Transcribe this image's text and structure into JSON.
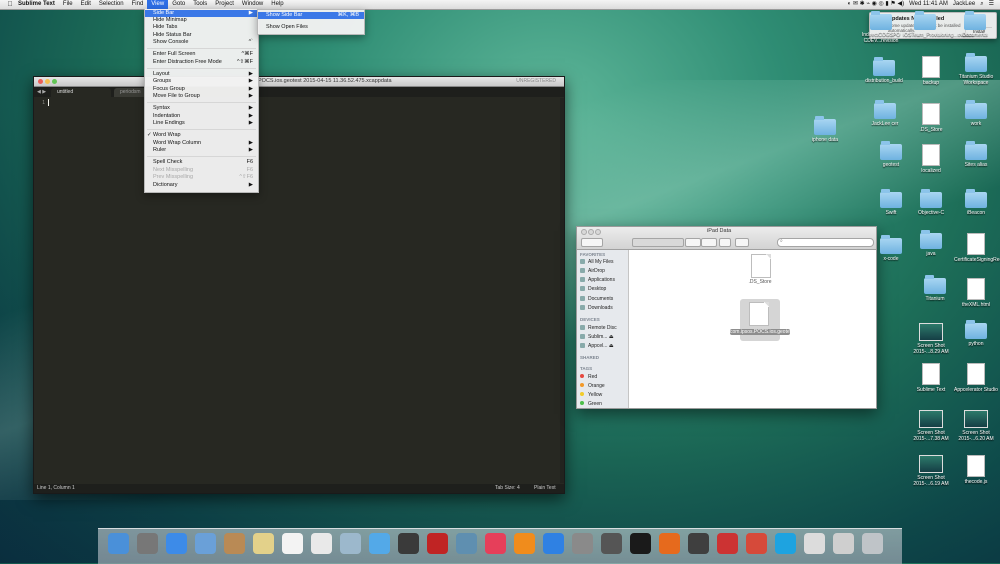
{
  "menubar": {
    "app": "Sublime Text",
    "items": [
      "File",
      "Edit",
      "Selection",
      "Find",
      "View",
      "Goto",
      "Tools",
      "Project",
      "Window",
      "Help"
    ],
    "active_index": 4,
    "clock": "Wed 11:41 AM",
    "user": "JackLee"
  },
  "view_menu": {
    "items": [
      {
        "label": "Side Bar",
        "shortcut": "▶",
        "state": "highlighted"
      },
      {
        "label": "Hide Minimap",
        "shortcut": ""
      },
      {
        "label": "Hide Tabs",
        "shortcut": ""
      },
      {
        "label": "Hide Status Bar",
        "shortcut": ""
      },
      {
        "label": "Show Console",
        "shortcut": "^`"
      },
      {
        "label": "Enter Full Screen",
        "shortcut": "^⌘F"
      },
      {
        "label": "Enter Distraction Free Mode",
        "shortcut": "^⇧⌘F"
      },
      {
        "label": "Layout",
        "shortcut": "▶"
      },
      {
        "label": "Groups",
        "shortcut": "▶"
      },
      {
        "label": "Focus Group",
        "shortcut": "▶"
      },
      {
        "label": "Move File to Group",
        "shortcut": "▶"
      },
      {
        "label": "Syntax",
        "shortcut": "▶"
      },
      {
        "label": "Indentation",
        "shortcut": "▶"
      },
      {
        "label": "Line Endings",
        "shortcut": "▶"
      },
      {
        "label": "Word Wrap",
        "shortcut": "",
        "checked": true
      },
      {
        "label": "Word Wrap Column",
        "shortcut": "▶"
      },
      {
        "label": "Ruler",
        "shortcut": "▶"
      },
      {
        "label": "Spell Check",
        "shortcut": "F6"
      },
      {
        "label": "Next Misspelling",
        "shortcut": "F6",
        "state": "disabled"
      },
      {
        "label": "Prev Misspelling",
        "shortcut": "^⇧F6",
        "state": "disabled"
      },
      {
        "label": "Dictionary",
        "shortcut": "▶"
      }
    ]
  },
  "sidebar_submenu": {
    "items": [
      {
        "label": "Show Side Bar",
        "shortcut": "⌘K, ⌘B",
        "state": "highlighted"
      },
      {
        "label": "Show Open Files",
        "shortcut": ""
      }
    ]
  },
  "sublime": {
    "title": "POCS.ios.geotest 2015-04-15 11.36.52.475.xcappdata",
    "unregistered": "UNREGISTERED",
    "tabs": [
      "untitled",
      "periodsm"
    ],
    "line_number": "1",
    "status_left": "Line 1, Column 1",
    "tab_size": "Tab Size: 4",
    "syntax": "Plain Text"
  },
  "finder": {
    "title": "iPad Data",
    "search_placeholder": "",
    "sections": {
      "favorites": "FAVORITES",
      "devices": "DEVICES",
      "shared": "SHARED",
      "tags": "TAGS"
    },
    "favorites": [
      "All My Files",
      "AirDrop",
      "Applications",
      "Desktop",
      "Documents",
      "Downloads"
    ],
    "devices": [
      "Remote Disc",
      "Sublim...",
      "Appcel..."
    ],
    "tags": [
      {
        "label": "Red",
        "color": "#e5483f"
      },
      {
        "label": "Orange",
        "color": "#f39a2a"
      },
      {
        "label": "Yellow",
        "color": "#f2cc2a"
      },
      {
        "label": "Green",
        "color": "#4cbf4a"
      }
    ],
    "files": [
      {
        "name": ".DS_Store"
      },
      {
        "name": "com.ipsos.POCS.ios.geotest...xcappdata"
      }
    ]
  },
  "notification": {
    "title": "Updates Not Installed",
    "body": "Some updates could not be installed automatically.",
    "details": "Details",
    "install": "Install"
  },
  "desktop": [
    {
      "label": "IndirectCOGSPO CDEV...revision",
      "type": "folder"
    },
    {
      "label": "iOSTeam_Provisioning...ovision",
      "type": "folder"
    },
    {
      "label": "Documents",
      "type": "folder"
    },
    {
      "label": "distribution_build",
      "type": "folder"
    },
    {
      "label": "backup",
      "type": "doc"
    },
    {
      "label": "Titanium Studio Workspace",
      "type": "folder"
    },
    {
      "label": "iphone data",
      "type": "folder"
    },
    {
      "label": "JackLee cer",
      "type": "folder"
    },
    {
      "label": ".DS_Store",
      "type": "doc"
    },
    {
      "label": "work",
      "type": "folder"
    },
    {
      "label": "geotest",
      "type": "folder"
    },
    {
      "label": "localized",
      "type": "doc"
    },
    {
      "label": "Sites alias",
      "type": "folder"
    },
    {
      "label": "Swift",
      "type": "folder"
    },
    {
      "label": "Objective-C",
      "type": "folder"
    },
    {
      "label": "iBeacon",
      "type": "folder"
    },
    {
      "label": "x-code",
      "type": "folder"
    },
    {
      "label": "java",
      "type": "folder"
    },
    {
      "label": "CertificateSigningRequ...Request",
      "type": "doc"
    },
    {
      "label": "Titanium",
      "type": "folder"
    },
    {
      "label": "theXML.html",
      "type": "doc"
    },
    {
      "label": "Screen Shot 2015-...8.29 AM",
      "type": "shot"
    },
    {
      "label": "python",
      "type": "folder"
    },
    {
      "label": "Sublime Text",
      "type": "doc"
    },
    {
      "label": "Appcelerator Studio",
      "type": "doc"
    },
    {
      "label": "Screen Shot 2015-...7.38 AM",
      "type": "shot"
    },
    {
      "label": "Screen Shot 2015-...6.20 AM",
      "type": "shot"
    },
    {
      "label": "Screen Shot 2015-...6.19 AM",
      "type": "shot"
    },
    {
      "label": "thecode.js",
      "type": "doc"
    }
  ],
  "dock": [
    {
      "name": "finder",
      "color": "#4a90d9"
    },
    {
      "name": "launchpad",
      "color": "#777"
    },
    {
      "name": "safari",
      "color": "#3d8be8"
    },
    {
      "name": "mail",
      "color": "#6aa0d8"
    },
    {
      "name": "contacts",
      "color": "#b98a55"
    },
    {
      "name": "notes",
      "color": "#e3d18a"
    },
    {
      "name": "calendar",
      "color": "#f3f3f3"
    },
    {
      "name": "reminders",
      "color": "#e9e9e9"
    },
    {
      "name": "preview",
      "color": "#9cb8cc"
    },
    {
      "name": "messages",
      "color": "#53a9e8"
    },
    {
      "name": "facetime",
      "color": "#3a3a3a"
    },
    {
      "name": "photo-booth",
      "color": "#c02424"
    },
    {
      "name": "iphoto",
      "color": "#5f8fb0"
    },
    {
      "name": "itunes",
      "color": "#e63f5a"
    },
    {
      "name": "ibooks",
      "color": "#f08c1c"
    },
    {
      "name": "app-store",
      "color": "#2f81e3"
    },
    {
      "name": "system-preferences",
      "color": "#8a8a8a"
    },
    {
      "name": "x-app",
      "color": "#555"
    },
    {
      "name": "terminal",
      "color": "#1a1a1a"
    },
    {
      "name": "firefox",
      "color": "#e66a1d"
    },
    {
      "name": "sublime-text",
      "color": "#3f3f3f"
    },
    {
      "name": "parallels",
      "color": "#c33"
    },
    {
      "name": "chrome",
      "color": "#d64a3a"
    },
    {
      "name": "skype",
      "color": "#1ea3e0"
    },
    {
      "name": "doc-stack",
      "color": "#dcdcdc"
    },
    {
      "name": "downloads-stack",
      "color": "#cfcfcf"
    },
    {
      "name": "trash",
      "color": "#bfc4c8"
    }
  ]
}
